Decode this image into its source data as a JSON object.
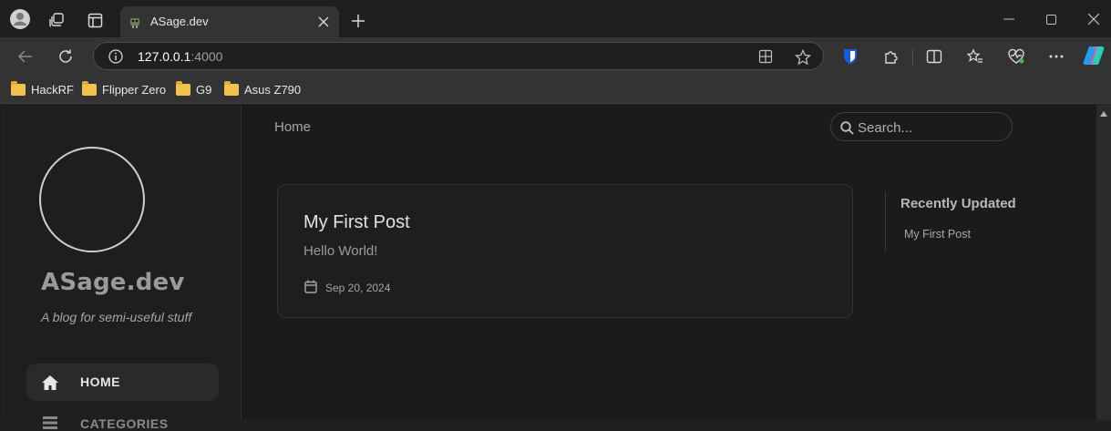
{
  "tab": {
    "title": "ASage.dev"
  },
  "address": {
    "host": "127.0.0.1",
    "port": ":4000"
  },
  "bookmarks": [
    "HackRF",
    "Flipper Zero",
    "G9",
    "Asus Z790"
  ],
  "sidebar": {
    "site_title": "ASage.dev",
    "subtitle": "A blog for semi-useful stuff",
    "nav": [
      {
        "label": "HOME",
        "icon": "home-icon"
      },
      {
        "label": "CATEGORIES",
        "icon": "categories-icon"
      }
    ]
  },
  "topbar": {
    "breadcrumb": "Home",
    "search_placeholder": "Search..."
  },
  "posts": [
    {
      "title": "My First Post",
      "excerpt": "Hello World!",
      "date": "Sep 20, 2024"
    }
  ],
  "panel": {
    "title": "Recently Updated",
    "items": [
      "My First Post"
    ]
  }
}
